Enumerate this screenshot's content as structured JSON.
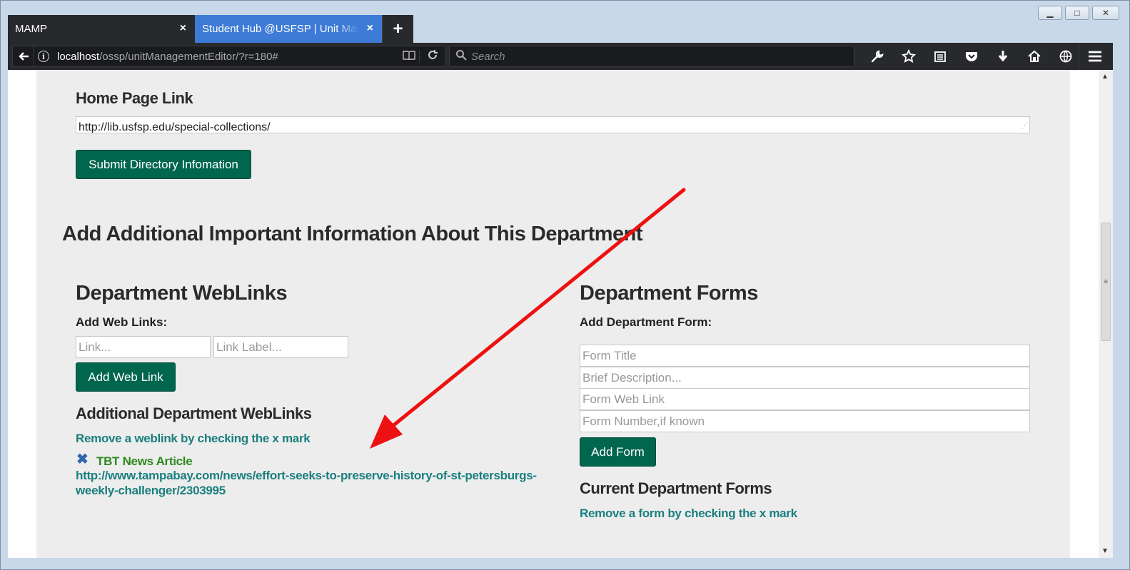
{
  "window": {
    "minimize_glyph": "▁",
    "maximize_glyph": "□",
    "close_glyph": "✕"
  },
  "tabs": [
    {
      "label": "MAMP",
      "close": "×"
    },
    {
      "label": "Student Hub @USFSP | Unit Management",
      "close": "×"
    }
  ],
  "new_tab_glyph": "+",
  "navbar": {
    "url_host": "localhost",
    "url_path": "/ossp/unitManagementEditor/?r=180#",
    "search_placeholder": "Search",
    "icons": [
      "wrench-icon",
      "star-icon",
      "reading-list-icon",
      "pocket-icon",
      "download-icon",
      "home-icon",
      "globe-icon",
      "menu-icon"
    ]
  },
  "page": {
    "home_link_label": "Home Page Link",
    "home_link_value": "http://lib.usfsp.edu/special-collections/",
    "submit_button": "Submit Directory Infomation",
    "section_heading": "Add Additional Important Information About This Department",
    "weblinks": {
      "heading": "Department WebLinks",
      "add_label": "Add Web Links:",
      "link_placeholder": "Link...",
      "label_placeholder": "Link Label...",
      "add_button": "Add Web Link",
      "additional_heading": "Additional Department WebLinks",
      "remove_hint": "Remove a weblink by checking the x mark",
      "items": [
        {
          "label": "TBT News Article",
          "url": "http://www.tampabay.com/news/effort-seeks-to-preserve-history-of-st-petersburgs-weekly-challenger/2303995"
        }
      ]
    },
    "forms": {
      "heading": "Department Forms",
      "add_label": "Add Department Form:",
      "title_placeholder": "Form Title",
      "description_placeholder": "Brief Description...",
      "weblink_placeholder": "Form Web Link",
      "number_placeholder": "Form Number,if known",
      "add_button": "Add Form",
      "current_heading": "Current Department Forms",
      "remove_hint": "Remove a form by checking the x mark"
    }
  },
  "colors": {
    "button_green": "#00664d",
    "link_teal": "#1b7f7f",
    "label_green": "#2d8a1e",
    "annotation_arrow": "#ee1111",
    "active_tab": "#3e7bd6"
  }
}
